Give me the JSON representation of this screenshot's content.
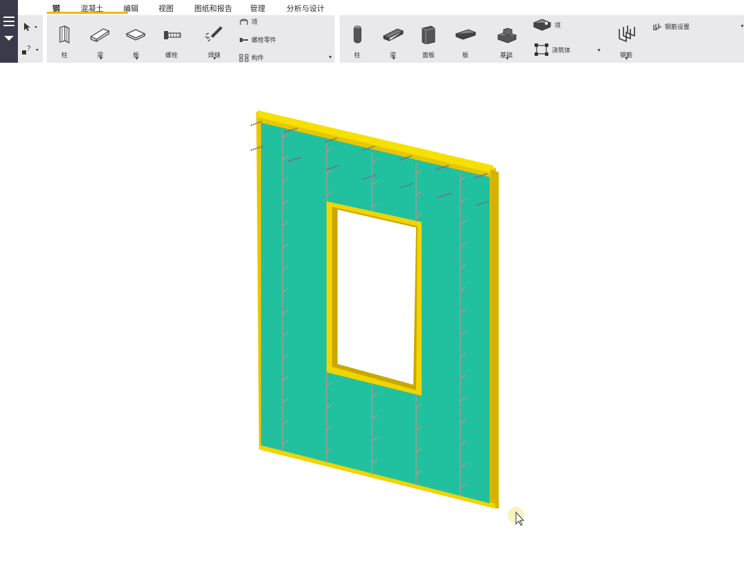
{
  "tabs": [
    {
      "label": "钢",
      "active": true
    },
    {
      "label": "混凝土",
      "active": false
    },
    {
      "label": "编辑",
      "active": false
    },
    {
      "label": "视图",
      "active": false
    },
    {
      "label": "图纸和报告",
      "active": false
    },
    {
      "label": "管理",
      "active": false
    },
    {
      "label": "分析与设计",
      "active": false
    }
  ],
  "steel": {
    "column": "柱",
    "beam": "梁",
    "plate": "板",
    "bolt": "螺栓",
    "weld": "焊缝",
    "item": "项",
    "bolt_part": "螺栓零件",
    "component": "构件"
  },
  "concrete": {
    "column": "柱",
    "beam": "梁",
    "panel": "面板",
    "slab": "板",
    "footing": "基础",
    "item": "项",
    "pour": "浇筑体",
    "rebar": "钢筋",
    "rebar_settings": "钢筋设置"
  },
  "icons": {
    "menu": "hamburger-icon",
    "select": "arrow-cursor-icon",
    "help": "question-icon"
  },
  "colors": {
    "accent": "#f5b400",
    "left_strip": "#3a3b4a",
    "ribbon": "#e9e9ec",
    "wall_face": "#21c19f",
    "frame": "#f2d400",
    "rebar": "#e08a8a"
  }
}
